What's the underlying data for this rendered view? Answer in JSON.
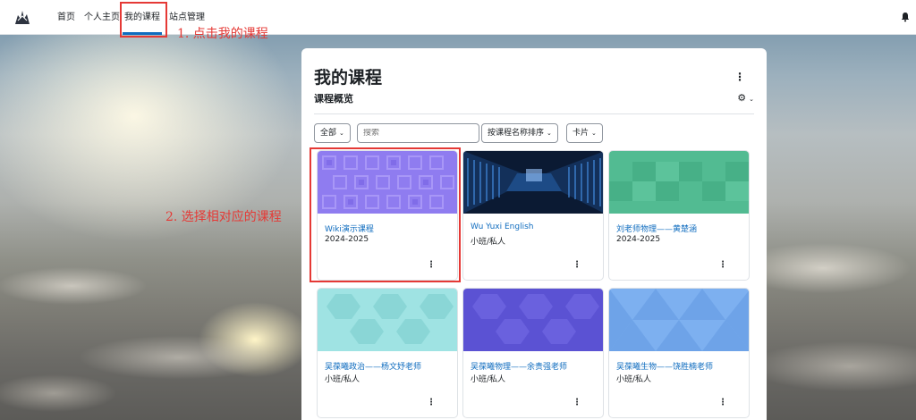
{
  "nav": {
    "items": [
      {
        "label": "首页"
      },
      {
        "label": "个人主页"
      },
      {
        "label": "我的课程"
      },
      {
        "label": "站点管理"
      }
    ]
  },
  "annotations": {
    "step1": "1. 点击我的课程",
    "step2": "2. 选择相对应的课程",
    "color": "#e53935"
  },
  "page": {
    "title": "我的课程",
    "section": "课程概览"
  },
  "filters": {
    "status": "全部",
    "search_placeholder": "搜索",
    "sort": "按课程名称排序",
    "view": "卡片"
  },
  "courses": [
    {
      "name": "Wiki演示课程",
      "category": "2024-2025",
      "image": "purple-squares"
    },
    {
      "name": "Wu Yuxi English",
      "category": "小班/私人",
      "image": "server-room"
    },
    {
      "name": "刘老师物理——黄楚涵",
      "category": "2024-2025",
      "image": "green-tiles"
    },
    {
      "name": "吴葆曦政治——杨文妤老师",
      "category": "小班/私人",
      "image": "cyan-hexagons"
    },
    {
      "name": "吴葆曦物理——余贵强老师",
      "category": "小班/私人",
      "image": "indigo-hexagons"
    },
    {
      "name": "吴葆曦生物——饶胜楠老师",
      "category": "小班/私人",
      "image": "blue-triangles"
    }
  ],
  "colors": {
    "accent": "#0f6cbf",
    "text": "#1d2125"
  }
}
